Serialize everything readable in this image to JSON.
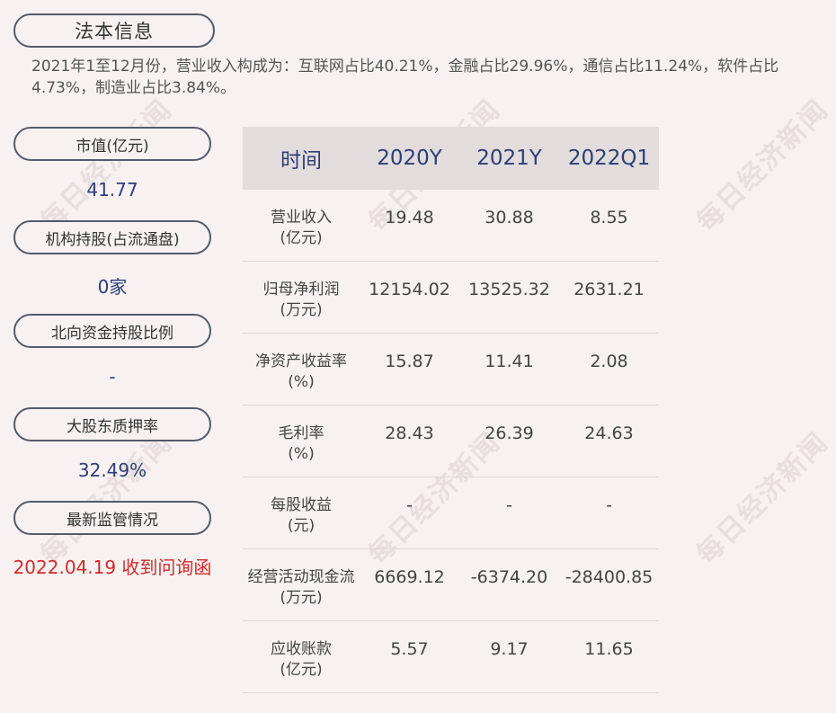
{
  "header": {
    "title": "法本信息"
  },
  "summary": "2021年1至12月份，营业收入构成为：互联网占比40.21%，金融占比29.96%，通信占比11.24%，软件占比4.73%，制造业占比3.84%。",
  "left_panel": {
    "items": [
      {
        "label": "市值(亿元)",
        "value": "41.77"
      },
      {
        "label": "机构持股(占流通盘)",
        "value": "0家"
      },
      {
        "label": "北向资金持股比例",
        "value": "-"
      },
      {
        "label": "大股东质押率",
        "value": "32.49%"
      },
      {
        "label": "最新监管情况",
        "value": "2022.04.19 收到问询函"
      }
    ]
  },
  "table": {
    "headers": [
      "时间",
      "2020Y",
      "2021Y",
      "2022Q1"
    ],
    "rows": [
      {
        "label_line1": "营业收入",
        "label_line2": "(亿元)",
        "values": [
          "19.48",
          "30.88",
          "8.55"
        ]
      },
      {
        "label_line1": "归母净利润",
        "label_line2": "(万元)",
        "values": [
          "12154.02",
          "13525.32",
          "2631.21"
        ]
      },
      {
        "label_line1": "净资产收益率",
        "label_line2": "(%)",
        "values": [
          "15.87",
          "11.41",
          "2.08"
        ]
      },
      {
        "label_line1": "毛利率",
        "label_line2": "(%)",
        "values": [
          "28.43",
          "26.39",
          "24.63"
        ]
      },
      {
        "label_line1": "每股收益",
        "label_line2": "(元)",
        "values": [
          "-",
          "-",
          "-"
        ]
      },
      {
        "label_line1": "经营活动现金流",
        "label_line2": "(万元)",
        "values": [
          "6669.12",
          "-6374.20",
          "-28400.85"
        ]
      },
      {
        "label_line1": "应收账款",
        "label_line2": "(亿元)",
        "values": [
          "5.57",
          "9.17",
          "11.65"
        ]
      }
    ]
  },
  "watermark": "每日经济新闻",
  "colors": {
    "background": "#f7f1f1",
    "header_bg": "#e2dcdc",
    "accent": "#2c3e7a",
    "alert": "#d12a2a"
  }
}
